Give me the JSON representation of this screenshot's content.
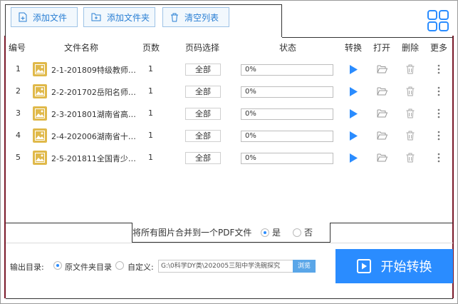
{
  "toolbar": {
    "add_file": "添加文件",
    "add_folder": "添加文件夹",
    "clear_list": "清空列表"
  },
  "table": {
    "headers": {
      "index": "编号",
      "name": "文件名称",
      "pages": "页数",
      "page_select": "页码选择",
      "status": "状态",
      "convert": "转换",
      "open": "打开",
      "delete": "删除",
      "more": "更多"
    },
    "rows": [
      {
        "index": "1",
        "name": "2-1-201809特级教师…",
        "pages": "1",
        "page_select": "全部",
        "progress": "0%"
      },
      {
        "index": "2",
        "name": "2-2-201702岳阳名师…",
        "pages": "1",
        "page_select": "全部",
        "progress": "0%"
      },
      {
        "index": "3",
        "name": "2-3-201801湖南省高…",
        "pages": "1",
        "page_select": "全部",
        "progress": "0%"
      },
      {
        "index": "4",
        "name": "2-4-202006湖南省十…",
        "pages": "1",
        "page_select": "全部",
        "progress": "0%"
      },
      {
        "index": "5",
        "name": "2-5-201811全国青少…",
        "pages": "1",
        "page_select": "全部",
        "progress": "0%"
      }
    ]
  },
  "merge": {
    "label": "将所有图片合并到一个PDF文件",
    "yes": "是",
    "no": "否"
  },
  "output": {
    "label": "输出目录:",
    "original_dir": "原文件夹目录",
    "custom": "自定义:",
    "path": "G:\\0科学DY类\\202005三阳中学洗碗探究",
    "browse": "浏览"
  },
  "start_button": "开始转换",
  "colors": {
    "accent": "#2a8cff",
    "thumb": "#e0b94a"
  }
}
